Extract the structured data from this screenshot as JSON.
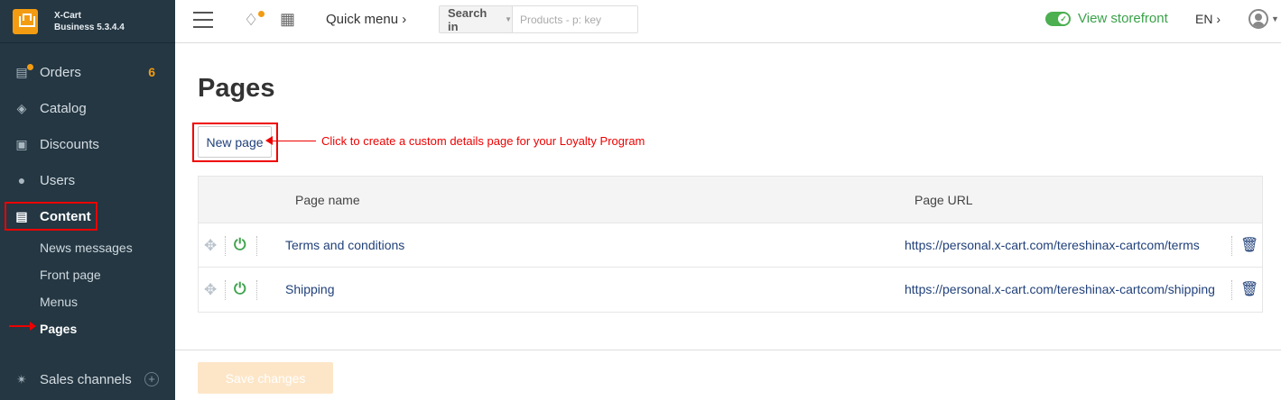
{
  "brand": {
    "name": "X-Cart",
    "edition": "Business 5.3.4.4"
  },
  "sidebar": {
    "items": [
      {
        "label": "Orders",
        "icon": "inbox-icon",
        "badge": "6"
      },
      {
        "label": "Catalog",
        "icon": "tags-icon"
      },
      {
        "label": "Discounts",
        "icon": "gift-icon"
      },
      {
        "label": "Users",
        "icon": "users-icon"
      },
      {
        "label": "Content",
        "icon": "newspaper-icon",
        "active": true
      }
    ],
    "content_sub": [
      "News messages",
      "Front page",
      "Menus",
      "Pages"
    ],
    "active_sub": "Pages",
    "sales_channels": "Sales channels"
  },
  "topbar": {
    "quick_menu": "Quick menu",
    "search_scope": "Search in",
    "search_placeholder": "Products - p: key",
    "storefront": "View storefront",
    "lang": "EN"
  },
  "main": {
    "title": "Pages",
    "new_page": "New page",
    "annotation": "Click to create a custom details page for your Loyalty Program",
    "columns": [
      "Page name",
      "Page URL"
    ],
    "rows": [
      {
        "name": "Terms and conditions",
        "url": "https://personal.x-cart.com/tereshinax-cartcom/terms"
      },
      {
        "name": "Shipping",
        "url": "https://personal.x-cart.com/tereshinax-cartcom/shipping"
      }
    ],
    "save": "Save changes"
  },
  "colors": {
    "sidebar": "#243743",
    "accent": "#f39c12",
    "link": "#21417a",
    "annotation": "#e00000",
    "storefront": "#3aa24a"
  }
}
